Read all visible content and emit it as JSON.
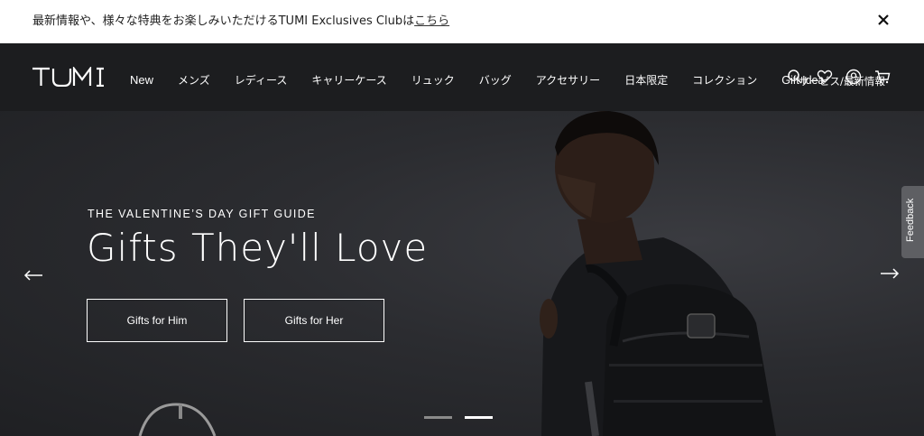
{
  "announcement": {
    "text": "最新情報や、様々な特典をお楽しみいただけるTUMI Exclusives Clubは",
    "link": "こちら"
  },
  "header": {
    "logo": "TUMI",
    "nav": [
      "New",
      "メンズ",
      "レディース",
      "キャリーケース",
      "リュック",
      "バッグ",
      "アクセサリー",
      "日本限定",
      "コレクション",
      "Gift Idea"
    ],
    "service": "サービス/最新情報"
  },
  "hero": {
    "eyebrow": "THE VALENTINE’S DAY GIFT GUIDE",
    "headline": "Gifts They'll Love",
    "cta_him": "Gifts for Him",
    "cta_her": "Gifts for Her",
    "slides_total": 2,
    "slide_active": 2
  },
  "feedback": "Feedback",
  "icons": [
    "close-icon",
    "search-icon",
    "heart-icon",
    "account-icon",
    "cart-icon",
    "arrow-left-icon",
    "arrow-right-icon"
  ]
}
